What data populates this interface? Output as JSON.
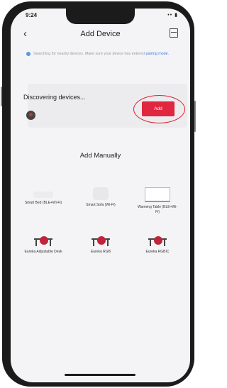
{
  "status_bar": {
    "time": "9:24",
    "icons": "•• ▮"
  },
  "header": {
    "title": "Add Device",
    "back_icon": "back-chevron-icon",
    "scan_icon": "scan-icon"
  },
  "notice": {
    "text": "Searching for nearby devices. Make sure your device has entered ",
    "link": "pairing mode."
  },
  "discover": {
    "title": "Discovering devices...",
    "add_label": "Add"
  },
  "manual": {
    "label": "Add Manually",
    "products": [
      {
        "name": "Smart Bed (BLE+Wi-Fi)",
        "icon": "bed-icon"
      },
      {
        "name": "Smart Sofa (Wi-Fi)",
        "icon": "sofa-icon"
      },
      {
        "name": "Warming Table (BLE+Wi-Fi)",
        "icon": "table-icon"
      },
      {
        "name": "Eureka Adjustable Desk",
        "icon": "desk-icon"
      },
      {
        "name": "Eureka RGB",
        "icon": "desk-rgb-icon"
      },
      {
        "name": "Eureka RGBIC",
        "icon": "desk-rgbic-icon"
      }
    ]
  },
  "colors": {
    "accent": "#e0273f",
    "link": "#3b7cd9",
    "highlight": "#d8202b"
  }
}
